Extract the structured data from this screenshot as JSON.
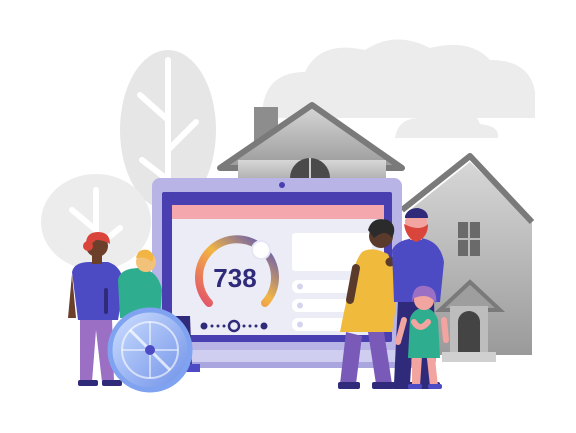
{
  "credit_score": {
    "value": "738"
  },
  "colors": {
    "gauge_start": "#e2506b",
    "gauge_mid": "#f2b544",
    "gauge_end": "#4c4bc4",
    "laptop_frame": "#4a3fb0",
    "laptop_bezel": "#b9b4e6",
    "screen_bg": "#ececf7",
    "screen_header": "#f4a8ae",
    "house_gray": "#8d8d8d",
    "tree_gray": "#d9d9d9",
    "skin_dark": "#5a3a2a",
    "shirt_yellow": "#f0bb3c",
    "shirt_purple": "#4c4bc4"
  },
  "icons": {
    "wheelchair": "wheelchair-icon",
    "house": "house-icon",
    "gauge": "credit-score-gauge-icon"
  }
}
